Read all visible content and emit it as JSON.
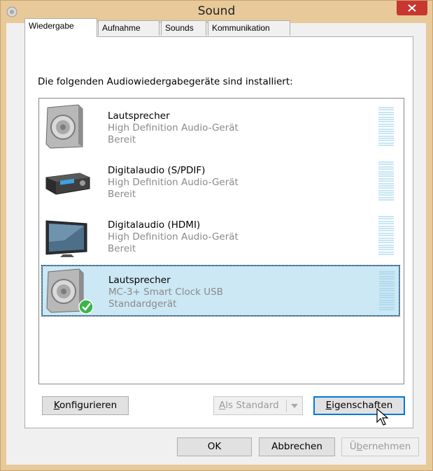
{
  "window": {
    "title": "Sound",
    "close_label": "close"
  },
  "tabs": [
    {
      "label": "Wiedergabe",
      "active": true
    },
    {
      "label": "Aufnahme",
      "active": false
    },
    {
      "label": "Sounds",
      "active": false
    },
    {
      "label": "Kommunikation",
      "active": false
    }
  ],
  "heading": "Die folgenden Audiowiedergabegeräte sind installiert:",
  "devices": [
    {
      "name": "Lautsprecher",
      "description": "High Definition Audio-Gerät",
      "status": "Bereit",
      "icon": "speaker-icon",
      "selected": false
    },
    {
      "name": "Digitalaudio (S/PDIF)",
      "description": "High Definition Audio-Gerät",
      "status": "Bereit",
      "icon": "receiver-icon",
      "selected": false
    },
    {
      "name": "Digitalaudio (HDMI)",
      "description": "High Definition Audio-Gerät",
      "status": "Bereit",
      "icon": "monitor-icon",
      "selected": false
    },
    {
      "name": "Lautsprecher",
      "description": "MC-3+ Smart Clock USB",
      "status": "Standardgerät",
      "icon": "speaker-default-icon",
      "selected": true
    }
  ],
  "buttons": {
    "configure": {
      "prefix": "",
      "accel": "K",
      "rest": "onfigurieren"
    },
    "set_default": {
      "prefix": "",
      "accel": "A",
      "rest": "ls Standard"
    },
    "properties": {
      "prefix": "",
      "accel": "E",
      "rest": "igenschaften"
    },
    "ok": "OK",
    "cancel": "Abbrechen",
    "apply": {
      "prefix": "Ü",
      "accel": "b",
      "rest": "ernehmen"
    }
  },
  "colors": {
    "selection": "#cce8f4",
    "close": "#c7372f",
    "frame": "#e8c99a"
  }
}
